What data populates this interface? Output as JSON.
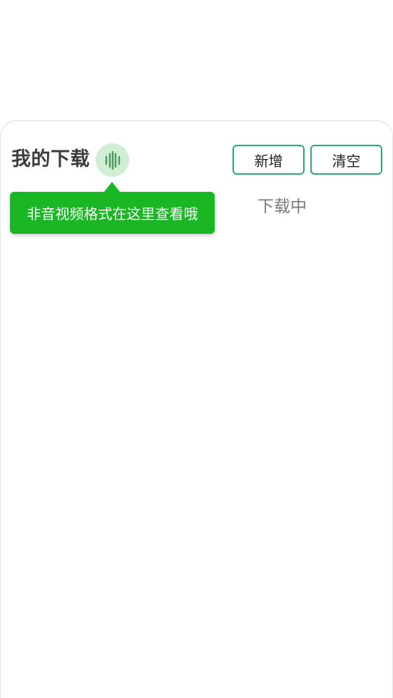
{
  "header": {
    "title": "我的下载",
    "wave_icon": "audio-wave-icon",
    "add_label": "新增",
    "clear_label": "清空"
  },
  "tooltip": {
    "text": "非音视频格式在这里查看哦"
  },
  "tabs": {
    "downloading_label": "下载中"
  },
  "colors": {
    "accent_green": "#1ab623",
    "button_border": "#2daa6c",
    "wave_bg": "#cfeed3",
    "title_text": "#3d3d3d"
  }
}
